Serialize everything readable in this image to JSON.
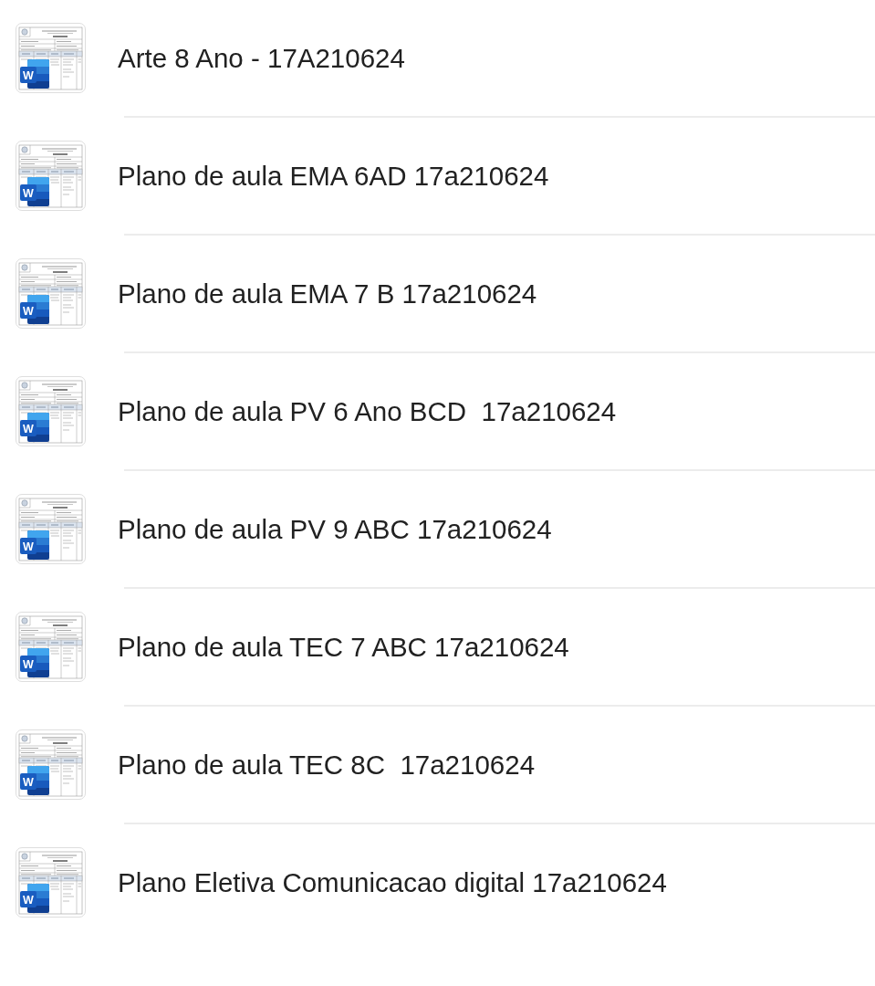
{
  "files": [
    {
      "name": "Arte 8 Ano - 17A210624",
      "app_badge": "W"
    },
    {
      "name": "Plano de aula EMA 6AD 17a210624",
      "app_badge": "W"
    },
    {
      "name": "Plano de aula EMA 7 B 17a210624",
      "app_badge": "W"
    },
    {
      "name": "Plano de aula PV 6 Ano BCD  17a210624",
      "app_badge": "W"
    },
    {
      "name": "Plano de aula PV 9 ABC 17a210624",
      "app_badge": "W"
    },
    {
      "name": "Plano de aula TEC 7 ABC 17a210624",
      "app_badge": "W"
    },
    {
      "name": "Plano de aula TEC 8C  17a210624",
      "app_badge": "W"
    },
    {
      "name": "Plano Eletiva Comunicacao digital 17a210624",
      "app_badge": "W"
    }
  ]
}
